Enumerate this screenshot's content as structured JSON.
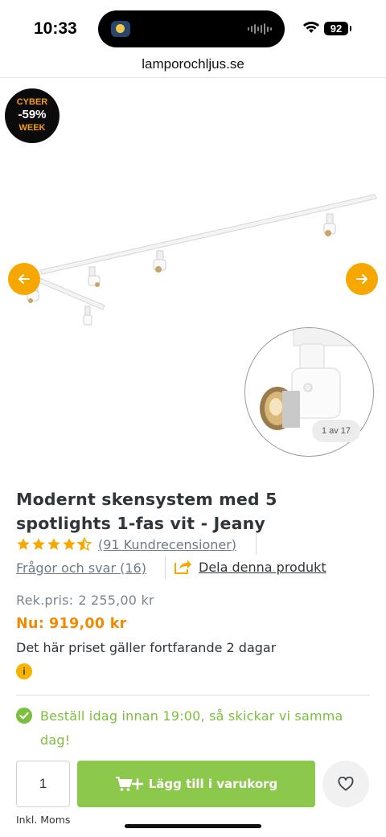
{
  "status_bar": {
    "time": "10:33",
    "battery": "92"
  },
  "browser": {
    "url": "lamporochljus.se"
  },
  "gallery": {
    "badge": {
      "top": "CYBER",
      "middle": "-59%",
      "bottom": "WEEK"
    },
    "counter": "1 av 17",
    "accent_color": "#f6a800"
  },
  "product": {
    "title": "Modernt skensystem med 5 spotlights 1-fas vit - Jeany",
    "rating": 4.5,
    "reviews_label": "(91 Kundrecensioner)",
    "qa_label": "Frågor och svar (16)",
    "share_label": "Dela denna produkt",
    "rek_label": "Rek.pris:",
    "rek_price": "2 255,00 kr",
    "now_label": "Nu:",
    "now_price": "919,00 kr",
    "price_note": "Det här priset gäller fortfarande 2 dagar",
    "info_icon": "i",
    "delivery_text": "Beställ idag innan 19:00, så skickar vi samma dag!"
  },
  "buy": {
    "quantity": "1",
    "add_label": "Lägg till i varukorg",
    "vat_note": "Inkl. Moms",
    "button_color": "#8cc84b"
  }
}
